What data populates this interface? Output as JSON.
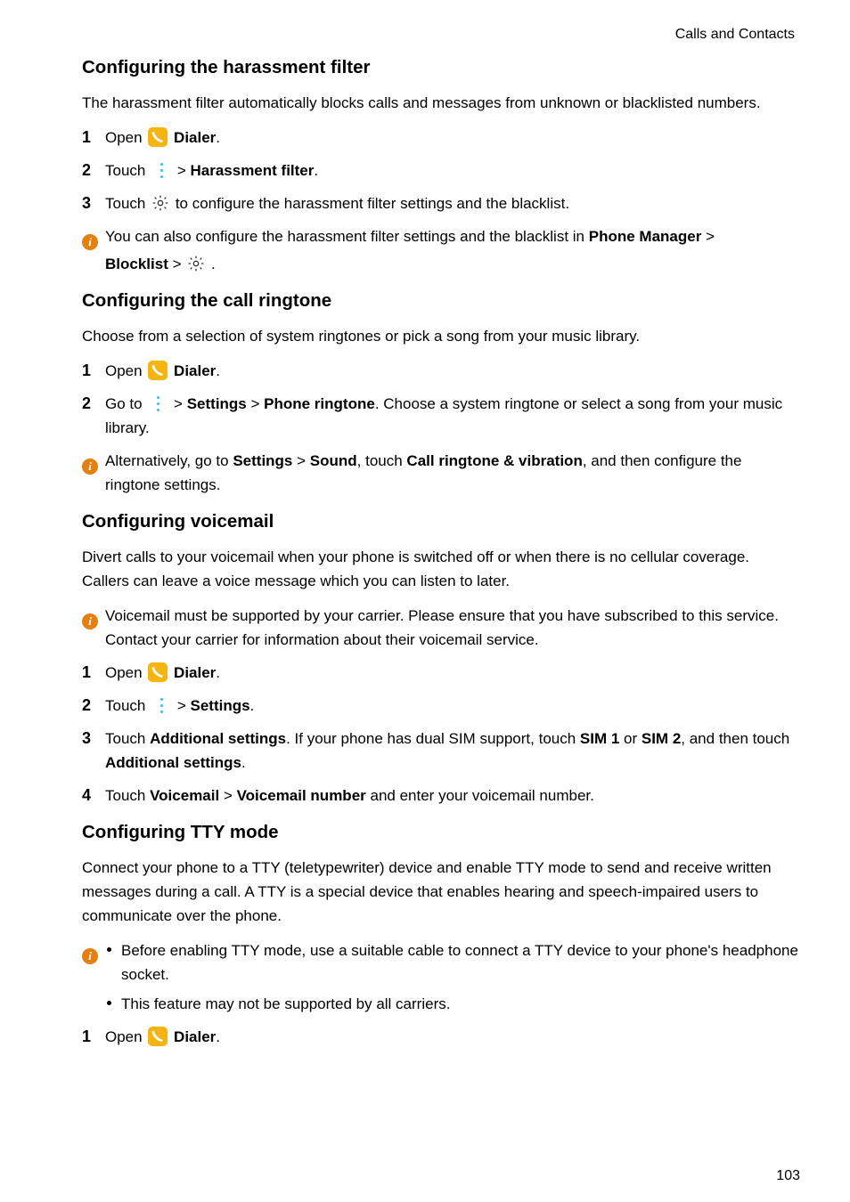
{
  "header": "Calls and Contacts",
  "pageNumber": "103",
  "icons": {
    "dialer_label": "Dialer",
    "gt": ">"
  },
  "s1": {
    "title": "Configuring the harassment filter",
    "intro": "The harassment filter automatically blocks calls and messages from unknown or blacklisted numbers.",
    "step1_a": "Open ",
    "step1_b": "Dialer",
    "step1_c": ".",
    "step2_a": "Touch ",
    "step2_b": " > ",
    "step2_c": "Harassment filter",
    "step2_d": ".",
    "step3_a": "Touch ",
    "step3_b": " to configure the harassment filter settings and the blacklist.",
    "note_a": "You can also configure the harassment filter settings and the blacklist in ",
    "note_b": "Phone Manager",
    "note_c": " > ",
    "note_d": "Blocklist",
    "note_e": " > ",
    "note_f": " ."
  },
  "s2": {
    "title": "Configuring the call ringtone",
    "intro": "Choose from a selection of system ringtones or pick a song from your music library.",
    "step1_a": "Open ",
    "step1_b": "Dialer",
    "step1_c": ".",
    "step2_a": "Go to ",
    "step2_b": " > ",
    "step2_c": "Settings",
    "step2_d": " > ",
    "step2_e": "Phone ringtone",
    "step2_f": ". Choose a system ringtone or select a song from your music library.",
    "note_a": "Alternatively, go to ",
    "note_b": "Settings",
    "note_c": " > ",
    "note_d": "Sound",
    "note_e": ", touch ",
    "note_f": "Call ringtone & vibration",
    "note_g": ", and then configure the ringtone settings."
  },
  "s3": {
    "title": "Configuring voicemail",
    "intro": "Divert calls to your voicemail when your phone is switched off or when there is no cellular coverage. Callers can leave a voice message which you can listen to later.",
    "note1": "Voicemail must be supported by your carrier. Please ensure that you have subscribed to this service. Contact your carrier for information about their voicemail service.",
    "step1_a": "Open ",
    "step1_b": "Dialer",
    "step1_c": ".",
    "step2_a": "Touch ",
    "step2_b": " > ",
    "step2_c": "Settings",
    "step2_d": ".",
    "step3_a": "Touch ",
    "step3_b": "Additional settings",
    "step3_c": ". If your phone has dual SIM support, touch ",
    "step3_d": "SIM 1",
    "step3_e": " or ",
    "step3_f": "SIM 2",
    "step3_g": ", and then touch ",
    "step3_h": "Additional settings",
    "step3_i": ".",
    "step4_a": "Touch ",
    "step4_b": "Voicemail",
    "step4_c": " > ",
    "step4_d": "Voicemail number",
    "step4_e": " and enter your voicemail number."
  },
  "s4": {
    "title": "Configuring TTY mode",
    "intro": "Connect your phone to a TTY (teletypewriter) device and enable TTY mode to send and receive written messages during a call. A TTY is a special device that enables hearing and speech-impaired users to communicate over the phone.",
    "bullet1": "Before enabling TTY mode, use a suitable cable to connect a TTY device to your phone's headphone socket.",
    "bullet2": "This feature may not be supported by all carriers.",
    "step1_a": "Open ",
    "step1_b": "Dialer",
    "step1_c": "."
  }
}
